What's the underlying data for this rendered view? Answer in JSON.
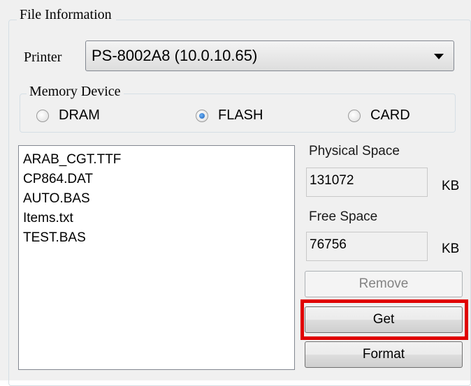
{
  "group_title": "File Information",
  "printer": {
    "label": "Printer",
    "selected": "PS-8002A8 (10.0.10.65)"
  },
  "memory_device": {
    "title": "Memory Device",
    "options": [
      {
        "label": "DRAM",
        "checked": false
      },
      {
        "label": "FLASH",
        "checked": true
      },
      {
        "label": "CARD",
        "checked": false
      }
    ]
  },
  "files": [
    "ARAB_CGT.TTF",
    "CP864.DAT",
    "AUTO.BAS",
    "Items.txt",
    "TEST.BAS"
  ],
  "physical_space": {
    "label": "Physical Space",
    "value": "131072",
    "unit": "KB"
  },
  "free_space": {
    "label": "Free Space",
    "value": "76756",
    "unit": "KB"
  },
  "buttons": {
    "remove": "Remove",
    "get": "Get",
    "format": "Format"
  },
  "colors": {
    "highlight": "#e00000",
    "panel_bg": "#f0f0f0"
  }
}
